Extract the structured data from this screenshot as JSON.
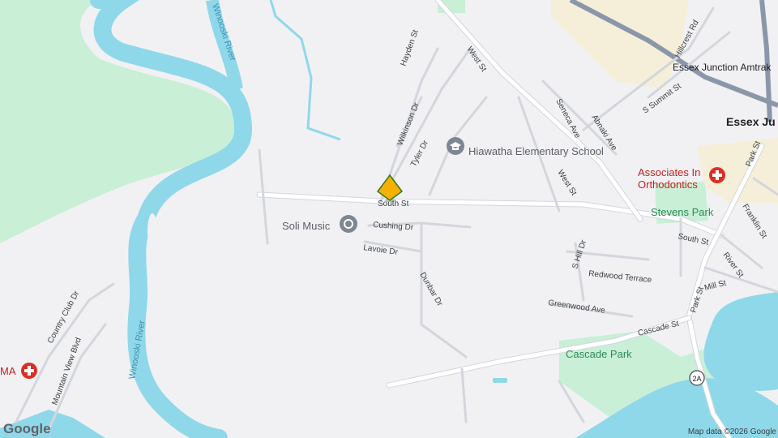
{
  "map": {
    "colors": {
      "land": "#f1f1f4",
      "water": "#8fd8ea",
      "park": "#c9efd7",
      "urban": "#f5efd9",
      "road": "#ffffff",
      "road_edge": "#d3d6dc",
      "rail": "#8a97aa",
      "pin": "#f6b100",
      "pin_edge": "#2f7a22",
      "medical": "#d93025"
    },
    "water": {
      "winooski_river_north": "Winooski River",
      "winooski_river_south": "Winooski River"
    },
    "streets": {
      "hayden": "Hayden St",
      "west_north": "West St",
      "wilkinson": "Wilkinson Dr",
      "tyler": "Tyler Dr",
      "south_st_pin": "South St",
      "cushing": "Cushing Dr",
      "lavoie": "Lavoie Dr",
      "dunbar": "Dunbar Dr",
      "seneca": "Seneca Ave",
      "abnaki": "Abnaki Ave",
      "s_summit": "S Summit St",
      "hillcrest": "Hillcrest Rd",
      "west_south": "West St",
      "park_north": "Park St",
      "franklin": "Franklin St",
      "south_st_east": "South St",
      "s_hill": "S Hill Dr",
      "redwood": "Redwood Terrace",
      "greenwood": "Greenwood Ave",
      "river": "River St",
      "mill": "Mill St",
      "park_south": "Park St",
      "cascade_st": "Cascade St",
      "country_club": "Country Club Dr",
      "mountain_view": "Mountain View Blvd",
      "route_shield": "2A"
    },
    "places": {
      "hiawatha": "Hiawatha Elementary School",
      "soli": "Soli Music",
      "associates_line1": "Associates In",
      "associates_line2": "Orthodontics",
      "stevens_park": "Stevens Park",
      "cascade_park": "Cascade Park",
      "ma_clinic": "MA"
    },
    "transit": {
      "station": "Essex Junction Amtrak",
      "town": "Essex Ju"
    },
    "icons": {
      "school": "school-icon",
      "music": "music-venue-icon",
      "medical": "medical-cross-icon",
      "pin": "location-pin-icon"
    },
    "attribution": "Map data ©2026 Google",
    "logo": "Google"
  }
}
